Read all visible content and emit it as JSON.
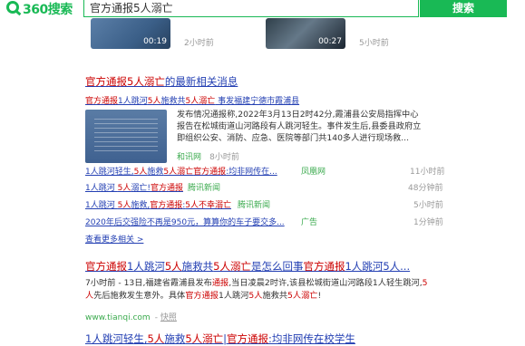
{
  "header": {
    "logo_text": "360搜索",
    "search_value": "官方通报5人溺亡",
    "search_button": "搜索"
  },
  "videos": [
    {
      "duration": "00:19",
      "time": "2小时前"
    },
    {
      "duration": "00:27",
      "time": "5小时前"
    }
  ],
  "news_block": {
    "title_pre": "官方通报5人溺亡",
    "title_post": "的最新相关消息",
    "top_link_parts": [
      "官方通报",
      "1人跳河",
      "5人",
      "施救共",
      "5人溺亡",
      " 事发福建宁德市霞浦县"
    ],
    "description": "发布情况通报称,2022年3月13日2时42分,霞浦县公安局指挥中心报告在松城街道山河路段有人跳河轻生。事件发生后,县委县政府立即组织公安、消防、应急、医院等部门共140多人进行现场救...",
    "source": "和讯网",
    "time": "8小时前",
    "rows": [
      {
        "parts": [
          "1人跳河轻生,",
          "5人",
          "施救",
          "5人溺亡",
          "官方通报",
          ":均非网传在..."
        ],
        "source": "凤凰网",
        "time": "11小时前"
      },
      {
        "parts": [
          "1人跳河 ",
          "5人",
          "溺亡!",
          "官方通报"
        ],
        "source": "腾讯新闻",
        "time": "48分钟前"
      },
      {
        "parts": [
          "1人跳河 ",
          "5人",
          "施救,",
          "官方通报",
          ":",
          "5人",
          "不幸溺亡"
        ],
        "source": "腾讯新闻",
        "time": "5小时前"
      },
      {
        "parts": [
          "2020年后交强险不再是950元，算算你的车子要交多..."
        ],
        "source": "广告",
        "time": "1分钟前"
      }
    ],
    "more_link": "查看更多相关 >"
  },
  "result2": {
    "title_parts": [
      "官方通报",
      "1人跳河",
      "5人",
      "施救共",
      "5人溺亡",
      "是怎么回事",
      "官方通报",
      "1人跳河",
      "5人..."
    ],
    "desc_line1_parts": [
      "7小时前 - 13日,福建省霞浦县发布",
      "通报",
      ",当日凌晨2时许,该县松城街道山河路段1人轻生跳河,",
      "5"
    ],
    "desc_line2_parts": [
      "人",
      "先后施救发生意外。具体",
      "官方通报",
      "1人跳河",
      "5人",
      "施救共",
      "5人溺亡",
      "!"
    ],
    "url": "www.tianqi.com",
    "snapshot": "快照"
  },
  "result3": {
    "title_parts": [
      "1人跳河轻生,",
      "5人",
      "施救",
      "5人溺亡",
      "|",
      "官方通报",
      ":均非网传在校学生"
    ]
  }
}
